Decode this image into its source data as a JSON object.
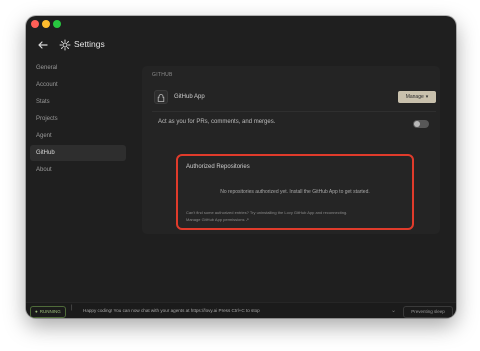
{
  "header": {
    "title": "Settings"
  },
  "sidebar": {
    "items": [
      {
        "label": "General"
      },
      {
        "label": "Account"
      },
      {
        "label": "Stats"
      },
      {
        "label": "Projects"
      },
      {
        "label": "Agent"
      },
      {
        "label": "GitHub"
      },
      {
        "label": "About"
      }
    ],
    "active_index": 5
  },
  "github": {
    "section_label": "GITHUB",
    "app_name": "GitHub App",
    "manage_label": "Manage",
    "act_as_label": "Act as you for PRs, comments, and merges.",
    "act_as_enabled": false
  },
  "authorized": {
    "title": "Authorized Repositories",
    "empty_text": "No repositories authorized yet. Install the GitHub App to get started.",
    "note_line1": "Can't find some authorized entries? Try uninstalling the Lovy GitHub App and reconnecting.",
    "note_line2": "Manage GitHub App permissions ↗"
  },
  "statusbar": {
    "badge": "RUNNING",
    "message": "Happy coding! You can now chat with your agents at https://lovy.ai  Press Ctrl+C to stop",
    "button": "Preventing sleep"
  },
  "colors": {
    "accent_highlight": "#e03b2b",
    "manage_button": "#c9c1ad",
    "running": "#9dbf7b"
  }
}
